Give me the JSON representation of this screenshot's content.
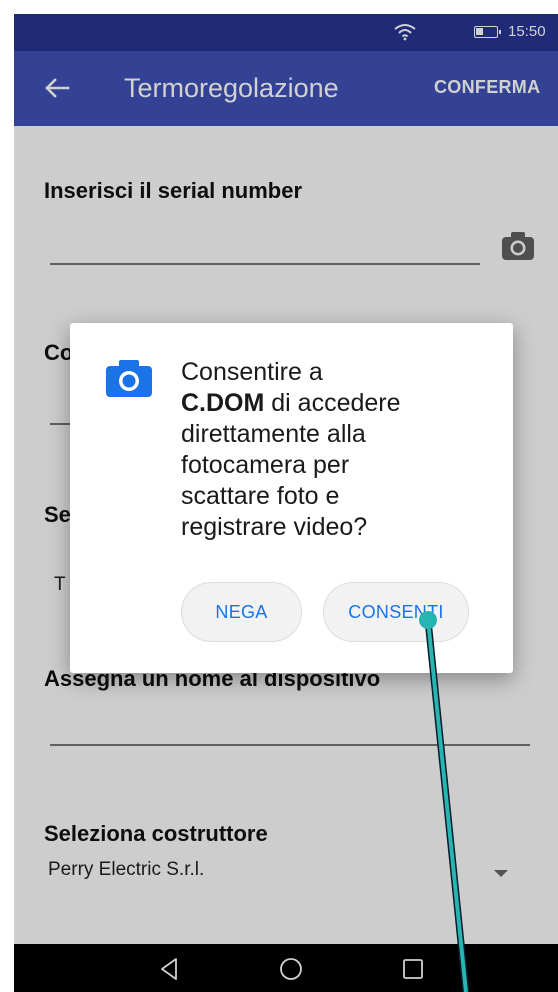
{
  "status_bar": {
    "time": "15:50",
    "wifi_icon": "wifi-icon",
    "battery_icon": "battery-icon"
  },
  "app_bar": {
    "title": "Termoregolazione",
    "confirm_label": "CONFERMA",
    "back_icon": "arrow-back-icon"
  },
  "form": {
    "serial_label": "Inserisci il serial number",
    "section2_label_partial": "Co",
    "section3_label_partial": "Se",
    "section3_value_partial": "T",
    "name_label": "Assegna un nome al dispositivo",
    "manufacturer_label": "Seleziona costruttore",
    "manufacturer_value": "Perry Electric S.r.l."
  },
  "dialog": {
    "icon": "camera-icon",
    "line1": "Consentire a",
    "app_name": "C.DOM",
    "line2_rest": " di accedere",
    "line3": "direttamente alla",
    "line4": "fotocamera per",
    "line5": "scattare foto e",
    "line6": "registrare video?",
    "deny_label": "NEGA",
    "allow_label": "CONSENTI"
  },
  "colors": {
    "primary": "#3f51b5",
    "primary_dark": "#283593",
    "accent": "#1a73e8",
    "pointer": "#26b5b0"
  }
}
